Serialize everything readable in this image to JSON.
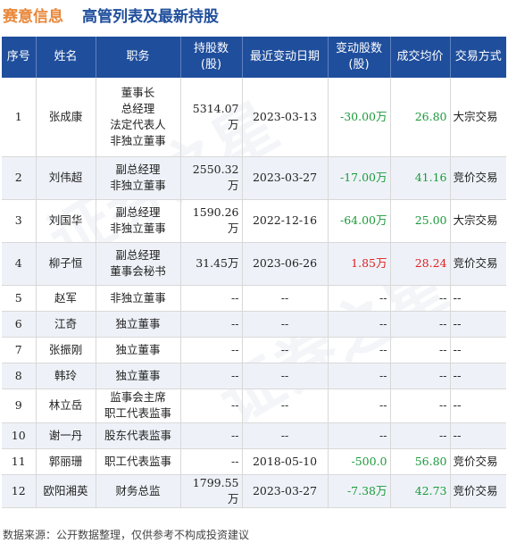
{
  "header": {
    "company": "赛意信息",
    "title": "高管列表及最新持股"
  },
  "columns": [
    "序号",
    "姓名",
    "职务",
    "持股数\n(股)",
    "最近变动日期",
    "变动股数\n(股)",
    "成交均价",
    "交易方式"
  ],
  "rows": [
    {
      "no": "1",
      "name": "张成康",
      "roles": [
        "董事长",
        "总经理",
        "法定代表人",
        "非独立董事"
      ],
      "shares": "5314.07万",
      "date": "2023-03-13",
      "change": "-30.00万",
      "change_sign": "neg",
      "price": "26.80",
      "price_sign": "neg",
      "method": "大宗交易"
    },
    {
      "no": "2",
      "name": "刘伟超",
      "roles": [
        "副总经理",
        "非独立董事"
      ],
      "shares": "2550.32万",
      "date": "2023-03-27",
      "change": "-17.00万",
      "change_sign": "neg",
      "price": "41.16",
      "price_sign": "neg",
      "method": "竞价交易"
    },
    {
      "no": "3",
      "name": "刘国华",
      "roles": [
        "副总经理",
        "非独立董事"
      ],
      "shares": "1590.26万",
      "date": "2022-12-16",
      "change": "-64.00万",
      "change_sign": "neg",
      "price": "25.00",
      "price_sign": "neg",
      "method": "大宗交易"
    },
    {
      "no": "4",
      "name": "柳子恒",
      "roles": [
        "副总经理",
        "董事会秘书"
      ],
      "shares": "31.45万",
      "date": "2023-06-26",
      "change": "1.85万",
      "change_sign": "pos",
      "price": "28.24",
      "price_sign": "pos",
      "method": "竞价交易"
    },
    {
      "no": "5",
      "name": "赵军",
      "roles": [
        "非独立董事"
      ],
      "shares": "--",
      "date": "--",
      "change": "--",
      "change_sign": "",
      "price": "--",
      "price_sign": "",
      "method": "--"
    },
    {
      "no": "6",
      "name": "江奇",
      "roles": [
        "独立董事"
      ],
      "shares": "--",
      "date": "--",
      "change": "--",
      "change_sign": "",
      "price": "--",
      "price_sign": "",
      "method": "--"
    },
    {
      "no": "7",
      "name": "张振刚",
      "roles": [
        "独立董事"
      ],
      "shares": "--",
      "date": "--",
      "change": "--",
      "change_sign": "",
      "price": "--",
      "price_sign": "",
      "method": "--"
    },
    {
      "no": "8",
      "name": "韩玲",
      "roles": [
        "独立董事"
      ],
      "shares": "--",
      "date": "--",
      "change": "--",
      "change_sign": "",
      "price": "--",
      "price_sign": "",
      "method": "--"
    },
    {
      "no": "9",
      "name": "林立岳",
      "roles": [
        "监事会主席",
        "职工代表监事"
      ],
      "shares": "--",
      "date": "--",
      "change": "--",
      "change_sign": "",
      "price": "--",
      "price_sign": "",
      "method": "--"
    },
    {
      "no": "10",
      "name": "谢一丹",
      "roles": [
        "股东代表监事"
      ],
      "shares": "--",
      "date": "--",
      "change": "--",
      "change_sign": "",
      "price": "--",
      "price_sign": "",
      "method": "--"
    },
    {
      "no": "11",
      "name": "郭丽珊",
      "roles": [
        "职工代表监事"
      ],
      "shares": "--",
      "date": "2018-05-10",
      "change": "-500.0",
      "change_sign": "neg",
      "price": "56.80",
      "price_sign": "neg",
      "method": "竞价交易"
    },
    {
      "no": "12",
      "name": "欧阳湘英",
      "roles": [
        "财务总监"
      ],
      "shares": "1799.55万",
      "date": "2023-03-27",
      "change": "-7.38万",
      "change_sign": "neg",
      "price": "42.73",
      "price_sign": "neg",
      "method": "竞价交易"
    }
  ],
  "footer": "数据来源：公开数据整理，仅供参考不构成投资建议",
  "colors": {
    "header_bg": "#1f4e9c",
    "company": "#e8873a",
    "up": "#e02020",
    "down": "#1a9a3a"
  }
}
